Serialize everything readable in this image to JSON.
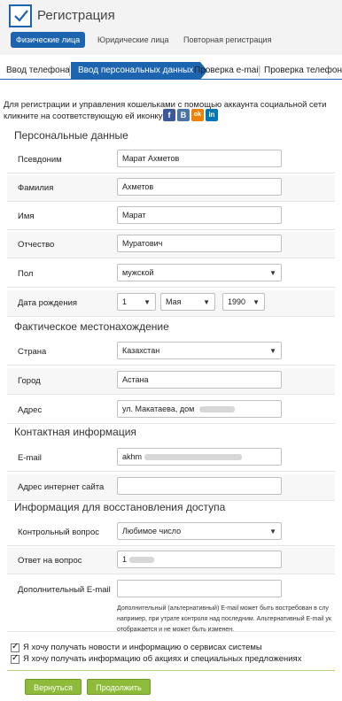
{
  "header": {
    "title": "Регистрация",
    "tabs": [
      {
        "label": "Физические лица",
        "active": true
      },
      {
        "label": "Юридические лица",
        "active": false
      },
      {
        "label": "Повторная регистрация",
        "active": false
      }
    ]
  },
  "steps": [
    {
      "label": "Ввод телефона",
      "active": false
    },
    {
      "label": "Ввод персональных данных",
      "active": true
    },
    {
      "label": "Проверка e-mail",
      "active": false
    },
    {
      "label": "Проверка телефона",
      "active": false
    }
  ],
  "social": {
    "note": "Для регистрации и управления кошельками с помощью аккаунта социальной сети кликните на соответствующую ей иконку",
    "icons": [
      {
        "name": "facebook-icon",
        "glyph": "f",
        "color": "#3b5998"
      },
      {
        "name": "vkontakte-icon",
        "glyph": "В",
        "color": "#4c75a3"
      },
      {
        "name": "odnoklassniki-icon",
        "glyph": "ok",
        "color": "#ee8208"
      },
      {
        "name": "linkedin-icon",
        "glyph": "in",
        "color": "#0077b5"
      }
    ]
  },
  "personal": {
    "title": "Персональные данные",
    "nickname": {
      "label": "Псевдоним",
      "value": "Марат Ахметов"
    },
    "surname": {
      "label": "Фамилия",
      "value": "Ахметов"
    },
    "name": {
      "label": "Имя",
      "value": "Марат"
    },
    "patronymic": {
      "label": "Отчество",
      "value": "Муратович"
    },
    "gender": {
      "label": "Пол",
      "value": "мужской"
    },
    "birthdate": {
      "label": "Дата рождения",
      "day": "1",
      "month": "Мая",
      "year": "1990"
    }
  },
  "location": {
    "title": "Фактическое местонахождение",
    "country": {
      "label": "Страна",
      "value": "Казахстан"
    },
    "city": {
      "label": "Город",
      "value": "Астана"
    },
    "address": {
      "label": "Адрес",
      "value": "ул. Макатаева, дом"
    }
  },
  "contact": {
    "title": "Контактная информация",
    "email": {
      "label": "E-mail",
      "value": "akhm"
    },
    "website": {
      "label": "Адрес интернет сайта",
      "value": ""
    }
  },
  "recovery": {
    "title": "Информация для восстановления доступа",
    "question": {
      "label": "Контрольный вопрос",
      "value": "Любимое число"
    },
    "answer": {
      "label": "Ответ на вопрос",
      "value": "1"
    },
    "alt_email": {
      "label": "Дополнительный E-mail",
      "value": ""
    },
    "hint_lines": [
      "Дополнительный (альтернативный) E-mail может быть востребован в слу",
      "например, при утрате контроля над последним. Альтернативный E-mail ук",
      "отображается и не может быть изменен."
    ]
  },
  "subscriptions": [
    {
      "label": "Я хочу получать новости и информацию о сервисах системы",
      "checked": true
    },
    {
      "label": "Я хочу получать информацию об акциях и специальных предложениях",
      "checked": true
    }
  ],
  "buttons": {
    "back": "Вернуться",
    "continue": "Продолжить"
  },
  "colors": {
    "accent": "#1d64b0",
    "button_green": "#8fbb3a"
  }
}
